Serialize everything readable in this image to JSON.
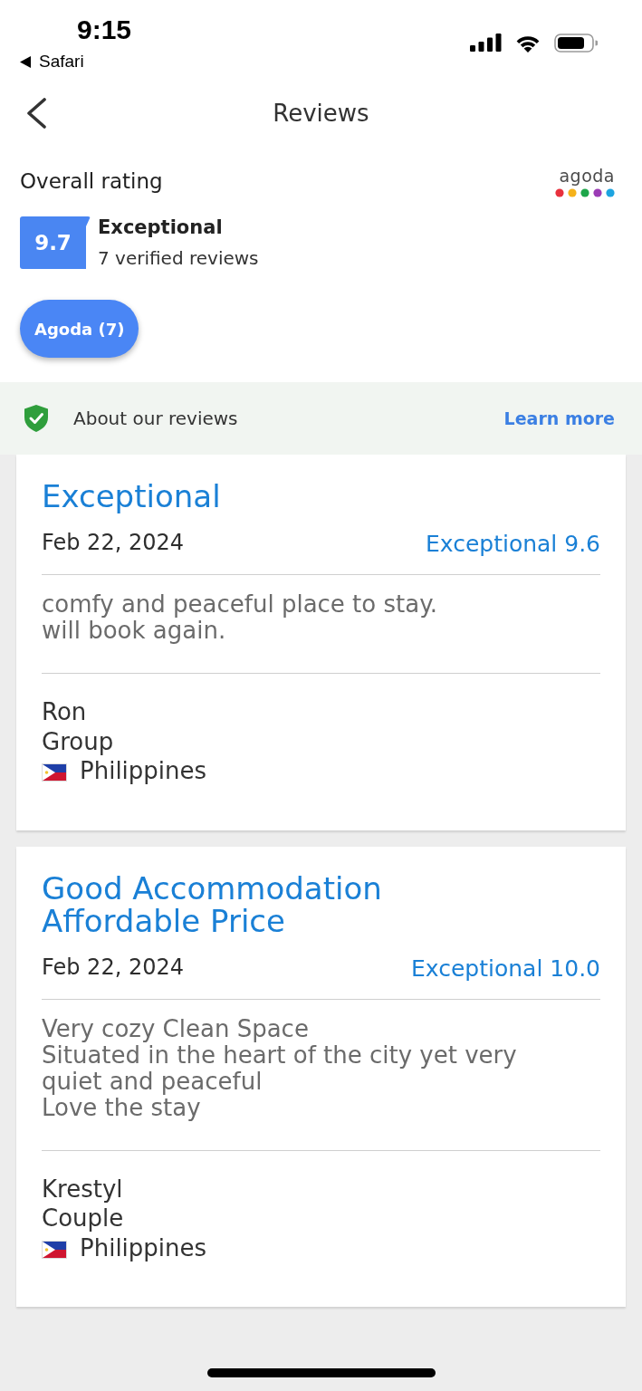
{
  "status_bar": {
    "time": "9:15",
    "back_app": "Safari"
  },
  "nav": {
    "title": "Reviews"
  },
  "overall": {
    "heading": "Overall rating",
    "logo_text": "agoda",
    "score": "9.7",
    "label": "Exceptional",
    "count": "7 verified reviews"
  },
  "filters": [
    {
      "label": "Agoda (7)",
      "selected": true
    }
  ],
  "about_banner": {
    "text": "About our reviews",
    "link": "Learn more"
  },
  "reviews": [
    {
      "title": "Exceptional",
      "date": "Feb 22, 2024",
      "rating": "Exceptional 9.6",
      "text": "comfy and peaceful place to stay.\nwill book again.",
      "reviewer": "Ron",
      "traveler_type": "Group",
      "country": "Philippines"
    },
    {
      "title": "Good Accommodation\nAffordable Price",
      "date": "Feb 22, 2024",
      "rating": "Exceptional 10.0",
      "text": "Very cozy Clean Space\nSituated in the heart of the city yet very\nquiet and peaceful\nLove the stay",
      "reviewer": "Krestyl",
      "traveler_type": "Couple",
      "country": "Philippines"
    }
  ]
}
